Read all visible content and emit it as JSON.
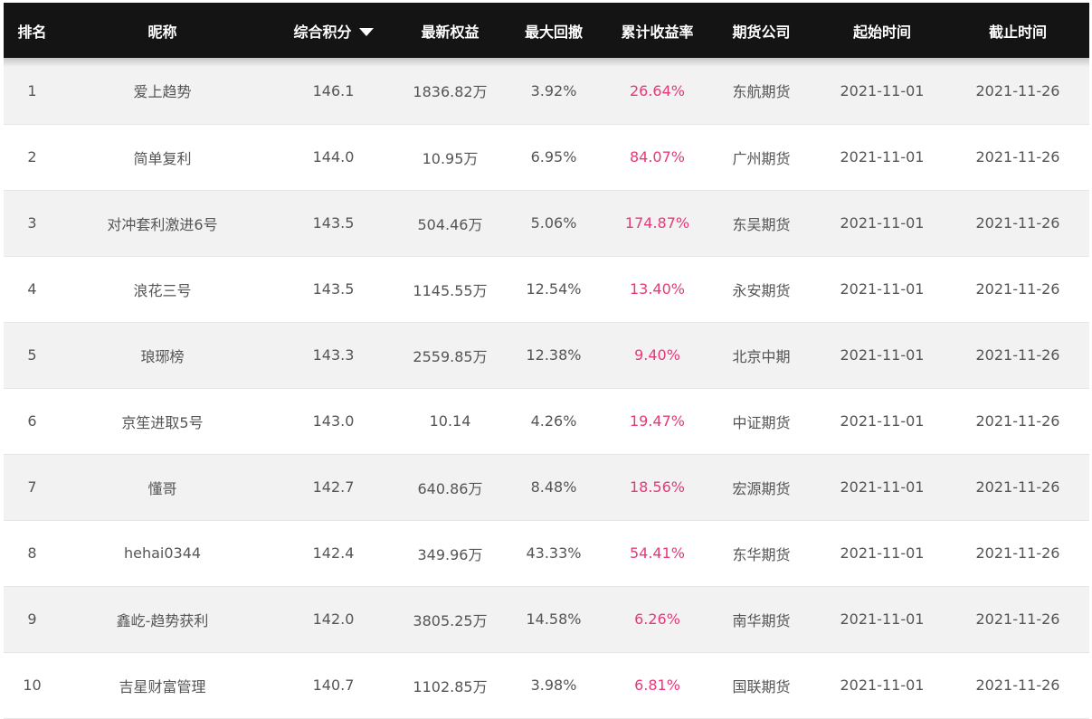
{
  "columns": {
    "rank": "排名",
    "nickname": "昵称",
    "score": "综合积分",
    "equity": "最新权益",
    "drawdown": "最大回撤",
    "return_rate": "累计收益率",
    "broker": "期货公司",
    "start": "起始时间",
    "end": "截止时间"
  },
  "sort_icon": "caret-down-icon",
  "colors": {
    "header_bg": "#141414",
    "return_rate": "#e8387a",
    "row_alt": "#f2f2f2"
  },
  "rows": [
    {
      "rank": "1",
      "nickname": "爱上趋势",
      "score": "146.1",
      "equity": "1836.82万",
      "drawdown": "3.92%",
      "return_rate": "26.64%",
      "broker": "东航期货",
      "start": "2021-11-01",
      "end": "2021-11-26"
    },
    {
      "rank": "2",
      "nickname": "简单复利",
      "score": "144.0",
      "equity": "10.95万",
      "drawdown": "6.95%",
      "return_rate": "84.07%",
      "broker": "广州期货",
      "start": "2021-11-01",
      "end": "2021-11-26"
    },
    {
      "rank": "3",
      "nickname": "对冲套利激进6号",
      "score": "143.5",
      "equity": "504.46万",
      "drawdown": "5.06%",
      "return_rate": "174.87%",
      "broker": "东吴期货",
      "start": "2021-11-01",
      "end": "2021-11-26"
    },
    {
      "rank": "4",
      "nickname": "浪花三号",
      "score": "143.5",
      "equity": "1145.55万",
      "drawdown": "12.54%",
      "return_rate": "13.40%",
      "broker": "永安期货",
      "start": "2021-11-01",
      "end": "2021-11-26"
    },
    {
      "rank": "5",
      "nickname": "琅琊榜",
      "score": "143.3",
      "equity": "2559.85万",
      "drawdown": "12.38%",
      "return_rate": "9.40%",
      "broker": "北京中期",
      "start": "2021-11-01",
      "end": "2021-11-26"
    },
    {
      "rank": "6",
      "nickname": "京笙进取5号",
      "score": "143.0",
      "equity": "10.14",
      "drawdown": "4.26%",
      "return_rate": "19.47%",
      "broker": "中证期货",
      "start": "2021-11-01",
      "end": "2021-11-26"
    },
    {
      "rank": "7",
      "nickname": "懂哥",
      "score": "142.7",
      "equity": "640.86万",
      "drawdown": "8.48%",
      "return_rate": "18.56%",
      "broker": "宏源期货",
      "start": "2021-11-01",
      "end": "2021-11-26"
    },
    {
      "rank": "8",
      "nickname": "hehai0344",
      "score": "142.4",
      "equity": "349.96万",
      "drawdown": "43.33%",
      "return_rate": "54.41%",
      "broker": "东华期货",
      "start": "2021-11-01",
      "end": "2021-11-26"
    },
    {
      "rank": "9",
      "nickname": "鑫屹-趋势获利",
      "score": "142.0",
      "equity": "3805.25万",
      "drawdown": "14.58%",
      "return_rate": "6.26%",
      "broker": "南华期货",
      "start": "2021-11-01",
      "end": "2021-11-26"
    },
    {
      "rank": "10",
      "nickname": "吉星财富管理",
      "score": "140.7",
      "equity": "1102.85万",
      "drawdown": "3.98%",
      "return_rate": "6.81%",
      "broker": "国联期货",
      "start": "2021-11-01",
      "end": "2021-11-26"
    }
  ]
}
